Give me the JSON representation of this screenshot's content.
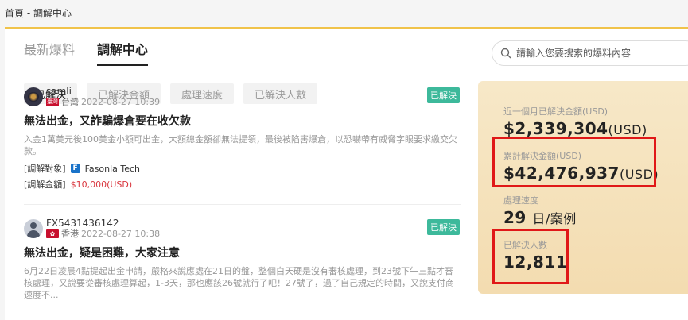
{
  "breadcrumb": "首頁 - 調解中心",
  "tabs": [
    {
      "label": "最新爆料",
      "active": false
    },
    {
      "label": "調解中心",
      "active": true
    }
  ],
  "search": {
    "placeholder": "請輸入您要搜索的爆料內容"
  },
  "filters": [
    {
      "label": "已解決",
      "active": true
    },
    {
      "label": "已解決金額",
      "active": false
    },
    {
      "label": "處理速度",
      "active": false
    },
    {
      "label": "已解決人數",
      "active": false
    }
  ],
  "complaints": [
    {
      "username": "samli",
      "flag_label": "臺灣",
      "location": "台灣",
      "time": "2022-08-27 10:39",
      "status": "已解決",
      "title": "無法出金，又詐騙爆倉要在收欠款",
      "body": "入金1萬美元後100美金小額可出金，大額總金額卻無法提領，最後被陷害爆倉，以恐嚇帶有威脅字眼要求繳交欠款。",
      "target_label": "[調解對象]",
      "target": "Fasonla Tech",
      "amount_label": "[調解金額]",
      "amount": "$10,000(USD)"
    },
    {
      "username": "FX5431436142",
      "location": "香港",
      "time": "2022-08-27 10:38",
      "status": "已解決",
      "title": "無法出金，疑是困難，大家注意",
      "body": "6月22日凌晨4點提起出金申請，嚴格來說應處在21日的盤，整個白天硬是沒有審核處理，到23號下午三點才審核處理，又說要從審核處理算起，1-3天，那也應該26號就行了吧！27號了，過了自己規定的時間，又說支付商速度不..."
    }
  ],
  "stats": {
    "month_label": "近一個月已解決金額(USD)",
    "month_value": "$2,339,304",
    "month_unit": "(USD)",
    "total_label": "累計解決金額(USD)",
    "total_value": "$42,476,937",
    "total_unit": "(USD)",
    "speed_label": "處理速度",
    "speed_value": "29",
    "speed_unit": "日/案例",
    "people_label": "已解決人數",
    "people_value": "12,811"
  }
}
